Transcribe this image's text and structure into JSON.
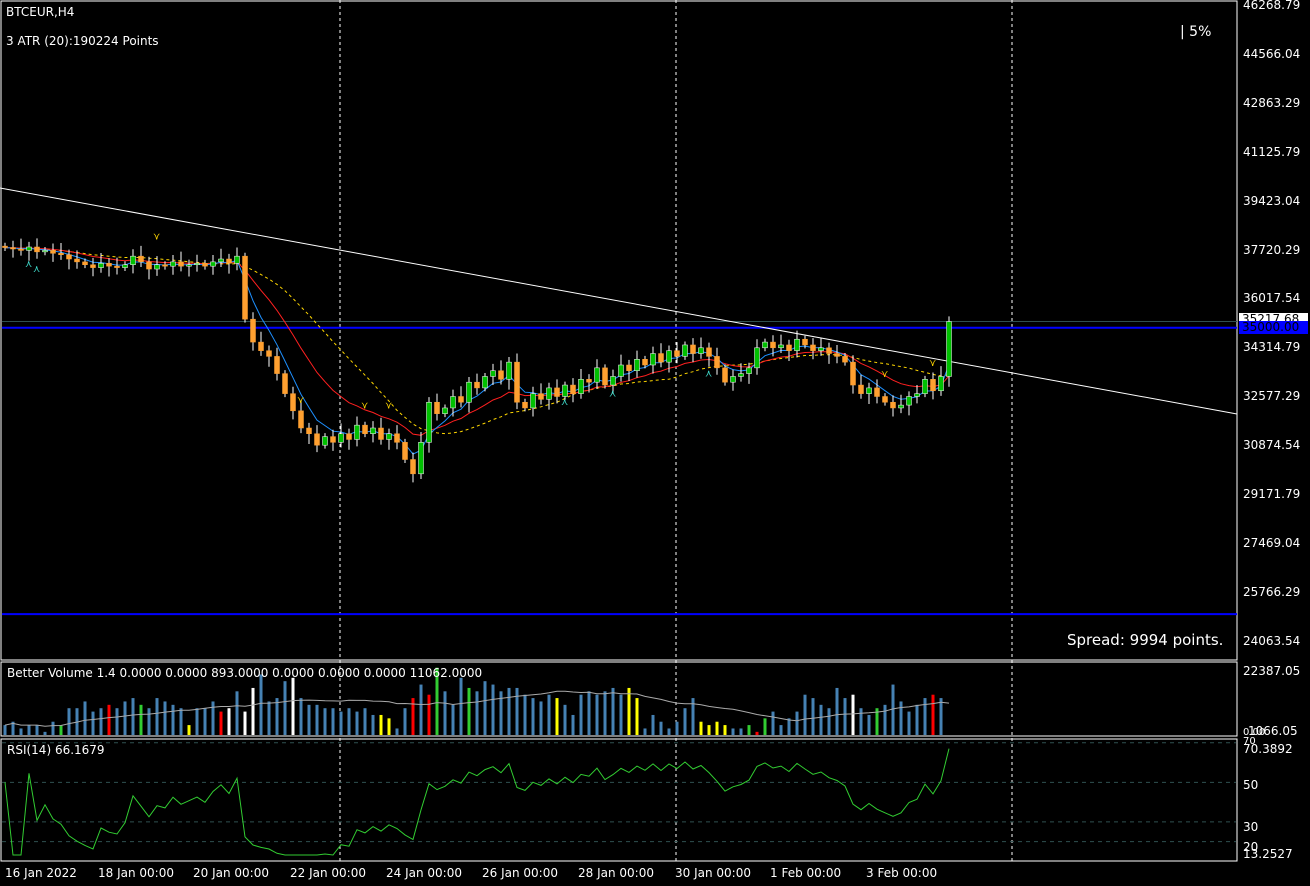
{
  "header": {
    "symbol": "BTCEUR,H4",
    "atr": "3 ATR (20):190224 Points",
    "percent": "| 5%",
    "spread": "Spread: 9994 points."
  },
  "price_axis": [
    "46268.79",
    "44566.04",
    "42863.29",
    "41125.79",
    "39423.04",
    "37720.29",
    "36017.54",
    "34314.79",
    "32577.29",
    "30874.54",
    "29171.79",
    "27469.04",
    "25766.29",
    "24063.54"
  ],
  "current_price": "35217.68",
  "level_price": "35000.00",
  "volume_panel": {
    "title": "Better Volume 1.4 0.0000 0.0000 893.0000 0.0000 0.0000 0.0000 11062.0000",
    "axis_max": "22387.05",
    "axis_min": "1066.05",
    "axis_zero": "0.00"
  },
  "rsi_panel": {
    "title": "RSI(14) 66.1679",
    "axis_max": "70.3892",
    "axis_70": "70",
    "axis_50": "50",
    "axis_30": "30",
    "axis_20": "20",
    "axis_min": "13.2527"
  },
  "dates": [
    "16 Jan 2022",
    "18 Jan 00:00",
    "20 Jan 00:00",
    "22 Jan 00:00",
    "24 Jan 00:00",
    "26 Jan 00:00",
    "28 Jan 00:00",
    "30 Jan 00:00",
    "1 Feb 00:00",
    "3 Feb 00:00"
  ],
  "colors": {
    "bull": "#00c000",
    "bear": "#ffa030",
    "blue_line": "#0000ff",
    "trend": "#ffffff",
    "ema_fast": "#1e90ff",
    "ema_slow": "#ff2020",
    "sma": "#ffd700",
    "vol": "#4682b4",
    "rsi": "#32cd32"
  },
  "chart_data": {
    "type": "candlestick",
    "price_range": [
      24063.54,
      46268.79
    ],
    "closes": [
      37800,
      37750,
      37700,
      37820,
      37650,
      37700,
      37600,
      37550,
      37400,
      37300,
      37200,
      37100,
      37250,
      37150,
      37100,
      37200,
      37500,
      37300,
      37050,
      37200,
      37150,
      37300,
      37150,
      37200,
      37250,
      37150,
      37300,
      37400,
      37250,
      37500,
      35300,
      34500,
      34200,
      34000,
      33400,
      32700,
      32100,
      31500,
      31300,
      30900,
      31200,
      31000,
      31300,
      31100,
      31600,
      31300,
      31500,
      31100,
      31300,
      31000,
      30400,
      29900,
      31000,
      32400,
      32000,
      32200,
      32600,
      32400,
      33100,
      32900,
      33300,
      33500,
      33200,
      33800,
      32400,
      32200,
      32700,
      32500,
      32900,
      32600,
      33000,
      32700,
      33200,
      33100,
      33600,
      33000,
      33300,
      33700,
      33500,
      33900,
      33700,
      34100,
      33800,
      34200,
      34000,
      34400,
      34100,
      34300,
      34000,
      33600,
      33100,
      33300,
      33400,
      33600,
      34300,
      34500,
      34300,
      34400,
      34200,
      34600,
      34400,
      34200,
      34300,
      34100,
      34000,
      33800,
      33000,
      32700,
      32900,
      32600,
      32400,
      32200,
      32300,
      32600,
      32700,
      33200,
      32800,
      33300,
      35217
    ],
    "horizontal_levels": [
      35000,
      25000
    ],
    "trendline": {
      "start_price": 39880,
      "end_price": 31990
    },
    "volume": [
      4,
      5,
      3,
      4,
      4,
      2,
      5,
      4,
      9,
      9,
      11,
      8,
      9,
      10,
      9,
      11,
      12,
      10,
      9,
      12,
      11,
      10,
      9,
      4,
      9,
      9,
      11,
      8,
      9,
      14,
      8,
      15,
      19,
      11,
      12,
      17,
      18,
      12,
      10,
      10,
      9,
      9,
      8,
      9,
      8,
      9,
      7,
      7,
      6,
      3,
      9,
      12,
      16,
      13,
      21,
      14,
      10,
      18,
      15,
      14,
      17,
      16,
      14,
      15,
      15,
      13,
      12,
      11,
      13,
      12,
      10,
      7,
      13,
      14,
      13,
      14,
      15,
      13,
      15,
      12,
      3,
      7,
      5,
      3,
      5,
      9,
      12,
      5,
      4,
      5,
      4,
      3,
      3,
      4,
      2,
      6,
      8,
      4,
      6,
      8,
      13,
      12,
      10,
      9,
      15,
      12,
      13,
      9,
      7,
      9,
      10,
      16,
      11,
      8,
      10,
      12,
      13,
      12,
      1
    ],
    "volume_unit": 1000,
    "volume_colors": {
      "7": "g",
      "13": "r",
      "17": "g",
      "23": "y",
      "27": "r",
      "28": "w",
      "30": "w",
      "31": "w",
      "36": "w",
      "47": "y",
      "48": "y",
      "51": "r",
      "53": "r",
      "54": "g",
      "58": "g",
      "69": "y",
      "78": "y",
      "79": "y",
      "87": "y",
      "88": "y",
      "89": "y",
      "90": "y",
      "93": "g",
      "94": "r",
      "95": "g",
      "106": "w",
      "109": "g",
      "116": "r",
      "118": "y"
    },
    "rsi_range": [
      13.2527,
      70.3892
    ]
  }
}
